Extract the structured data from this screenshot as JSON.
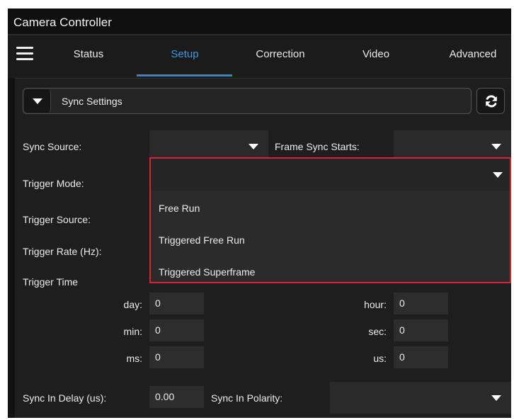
{
  "app": {
    "title": "Camera Controller"
  },
  "tabs": [
    {
      "label": "Status"
    },
    {
      "label": "Setup"
    },
    {
      "label": "Correction"
    },
    {
      "label": "Video"
    },
    {
      "label": "Advanced"
    }
  ],
  "active_tab": "Setup",
  "section": {
    "title": "Sync Settings"
  },
  "fields": {
    "sync_source": {
      "label": "Sync Source:",
      "value": ""
    },
    "frame_sync_starts": {
      "label": "Frame Sync Starts:",
      "value": ""
    },
    "trigger_mode": {
      "label": "Trigger Mode:",
      "value": "",
      "options": [
        "Free Run",
        "Triggered Free Run",
        "Triggered Superframe"
      ]
    },
    "trigger_source": {
      "label": "Trigger Source:"
    },
    "trigger_rate": {
      "label": "Trigger Rate (Hz):"
    },
    "trigger_time": {
      "label": "Trigger Time",
      "day": {
        "label": "day:",
        "value": "0"
      },
      "hour": {
        "label": "hour:",
        "value": "0"
      },
      "min": {
        "label": "min:",
        "value": "0"
      },
      "sec": {
        "label": "sec:",
        "value": "0"
      },
      "ms": {
        "label": "ms:",
        "value": "0"
      },
      "us": {
        "label": "us:",
        "value": "0"
      }
    },
    "sync_in_delay": {
      "label": "Sync In Delay (us):",
      "value": "0.00"
    },
    "sync_in_polarity": {
      "label": "Sync In Polarity:",
      "value": ""
    }
  },
  "colors": {
    "accent": "#3a9ae6",
    "highlight_border": "#d6262a",
    "background": "#1e1e1e"
  },
  "icons": {
    "menu": "hamburger-icon",
    "collapse": "triangle-down-icon",
    "refresh": "refresh-icon"
  }
}
